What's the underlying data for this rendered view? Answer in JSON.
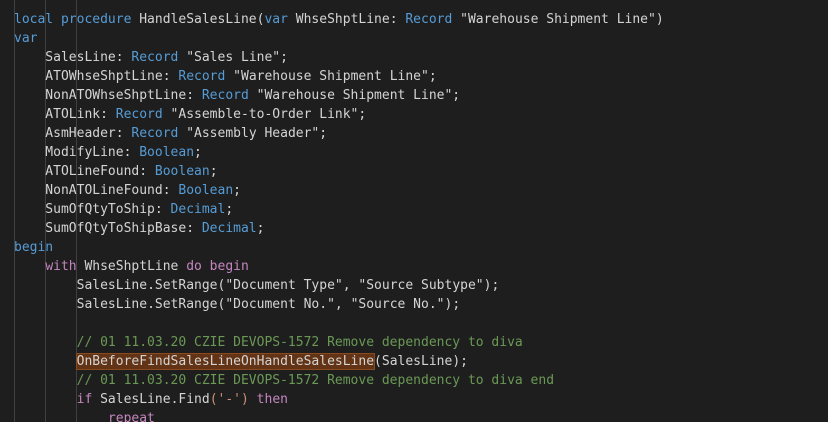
{
  "editor": {
    "lines": [
      {
        "tokens": [
          {
            "t": "local procedure ",
            "c": "kwb"
          },
          {
            "t": "HandleSalesLine",
            "c": "id"
          },
          {
            "t": "(",
            "c": "pun"
          },
          {
            "t": "var ",
            "c": "kwb"
          },
          {
            "t": "WhseShptLine",
            "c": "id"
          },
          {
            "t": ": ",
            "c": "pun"
          },
          {
            "t": "Record",
            "c": "tyb"
          },
          {
            "t": " \"Warehouse Shipment Line\"",
            "c": "id"
          },
          {
            "t": ")",
            "c": "pun"
          }
        ]
      },
      {
        "tokens": [
          {
            "t": "var",
            "c": "kwb"
          }
        ]
      },
      {
        "tokens": [
          {
            "t": "    SalesLine",
            "c": "id"
          },
          {
            "t": ": ",
            "c": "pun"
          },
          {
            "t": "Record",
            "c": "tyb"
          },
          {
            "t": " \"Sales Line\";",
            "c": "id"
          }
        ]
      },
      {
        "tokens": [
          {
            "t": "    ATOWhseShptLine",
            "c": "id"
          },
          {
            "t": ": ",
            "c": "pun"
          },
          {
            "t": "Record",
            "c": "tyb"
          },
          {
            "t": " \"Warehouse Shipment Line\";",
            "c": "id"
          }
        ]
      },
      {
        "tokens": [
          {
            "t": "    NonATOWhseShptLine",
            "c": "id"
          },
          {
            "t": ": ",
            "c": "pun"
          },
          {
            "t": "Record",
            "c": "tyb"
          },
          {
            "t": " \"Warehouse Shipment Line\";",
            "c": "id"
          }
        ]
      },
      {
        "tokens": [
          {
            "t": "    ATOLink",
            "c": "id"
          },
          {
            "t": ": ",
            "c": "pun"
          },
          {
            "t": "Record",
            "c": "tyb"
          },
          {
            "t": " \"Assemble-to-Order Link\";",
            "c": "id"
          }
        ]
      },
      {
        "tokens": [
          {
            "t": "    AsmHeader",
            "c": "id"
          },
          {
            "t": ": ",
            "c": "pun"
          },
          {
            "t": "Record",
            "c": "tyb"
          },
          {
            "t": " \"Assembly Header\";",
            "c": "id"
          }
        ]
      },
      {
        "tokens": [
          {
            "t": "    ModifyLine",
            "c": "id"
          },
          {
            "t": ": ",
            "c": "pun"
          },
          {
            "t": "Boolean",
            "c": "tyb"
          },
          {
            "t": ";",
            "c": "pun"
          }
        ]
      },
      {
        "tokens": [
          {
            "t": "    ATOLineFound",
            "c": "id"
          },
          {
            "t": ": ",
            "c": "pun"
          },
          {
            "t": "Boolean",
            "c": "tyb"
          },
          {
            "t": ";",
            "c": "pun"
          }
        ]
      },
      {
        "tokens": [
          {
            "t": "    NonATOLineFound",
            "c": "id"
          },
          {
            "t": ": ",
            "c": "pun"
          },
          {
            "t": "Boolean",
            "c": "tyb"
          },
          {
            "t": ";",
            "c": "pun"
          }
        ]
      },
      {
        "tokens": [
          {
            "t": "    SumOfQtyToShip",
            "c": "id"
          },
          {
            "t": ": ",
            "c": "pun"
          },
          {
            "t": "Decimal",
            "c": "tyb"
          },
          {
            "t": ";",
            "c": "pun"
          }
        ]
      },
      {
        "tokens": [
          {
            "t": "    SumOfQtyToShipBase",
            "c": "id"
          },
          {
            "t": ": ",
            "c": "pun"
          },
          {
            "t": "Decimal",
            "c": "tyb"
          },
          {
            "t": ";",
            "c": "pun"
          }
        ]
      },
      {
        "tokens": [
          {
            "t": "begin",
            "c": "kwb"
          }
        ]
      },
      {
        "tokens": [
          {
            "t": "    ",
            "c": "pun"
          },
          {
            "t": "with ",
            "c": "kw"
          },
          {
            "t": "WhseShptLine ",
            "c": "id"
          },
          {
            "t": "do begin",
            "c": "kw"
          }
        ]
      },
      {
        "tokens": [
          {
            "t": "        SalesLine",
            "c": "id"
          },
          {
            "t": ".",
            "c": "pun"
          },
          {
            "t": "SetRange",
            "c": "id"
          },
          {
            "t": "(\"Document Type\", \"Source Subtype\");",
            "c": "id"
          }
        ]
      },
      {
        "tokens": [
          {
            "t": "        SalesLine",
            "c": "id"
          },
          {
            "t": ".",
            "c": "pun"
          },
          {
            "t": "SetRange",
            "c": "id"
          },
          {
            "t": "(\"Document No.\", \"Source No.\");",
            "c": "id"
          }
        ]
      },
      {
        "tokens": []
      },
      {
        "tokens": [
          {
            "t": "        // 01 11.03.20 CZIE DEVOPS-1572 Remove dependency to diva",
            "c": "com"
          }
        ]
      },
      {
        "tokens": [
          {
            "t": "        ",
            "c": "pun"
          },
          {
            "t": "OnBeforeFindSalesLineOnHandleSalesLine",
            "c": "id",
            "hl": true
          },
          {
            "t": "(SalesLine);",
            "c": "id"
          }
        ]
      },
      {
        "tokens": [
          {
            "t": "        // 01 11.03.20 CZIE DEVOPS-1572 Remove dependency to diva end",
            "c": "com"
          }
        ]
      },
      {
        "tokens": [
          {
            "t": "        ",
            "c": "pun"
          },
          {
            "t": "if ",
            "c": "kw"
          },
          {
            "t": "SalesLine",
            "c": "id"
          },
          {
            "t": ".",
            "c": "pun"
          },
          {
            "t": "Find",
            "c": "id"
          },
          {
            "t": "('-') ",
            "c": "str"
          },
          {
            "t": "then",
            "c": "kw"
          }
        ]
      },
      {
        "tokens": [
          {
            "t": "            ",
            "c": "pun"
          },
          {
            "t": "repeat",
            "c": "kw"
          }
        ]
      }
    ]
  }
}
